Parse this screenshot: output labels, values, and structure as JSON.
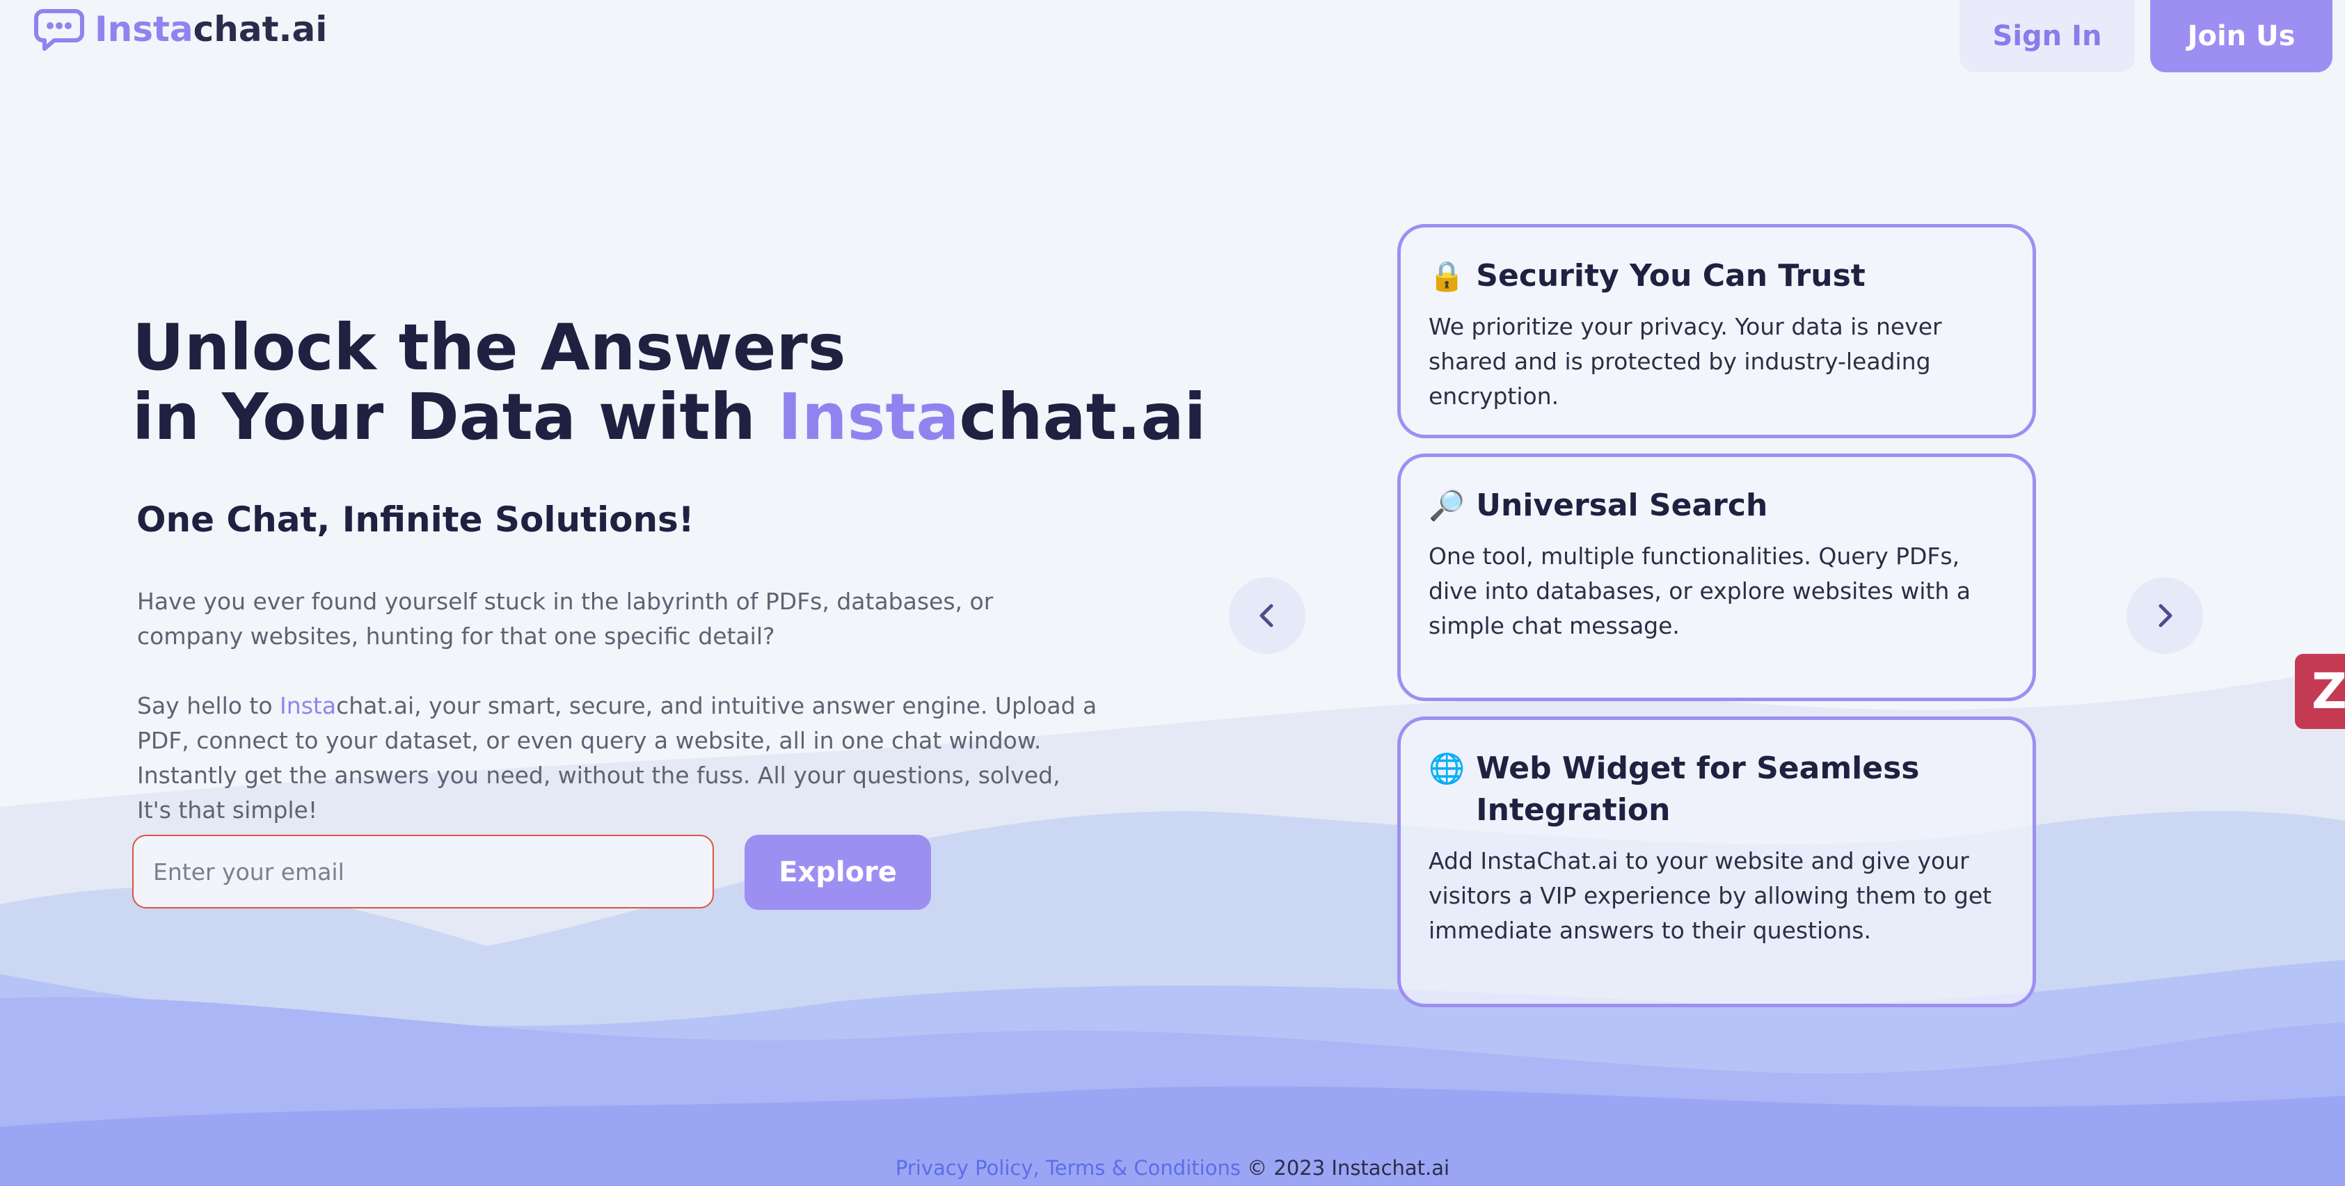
{
  "brand": {
    "name_part1": "Insta",
    "name_part2": "chat.ai",
    "accent_color": "#9282ef",
    "logo_icon": "chat-bubble-icon"
  },
  "header": {
    "signin_label": "Sign In",
    "join_label": "Join Us"
  },
  "hero": {
    "title_line1": "Unlock the Answers",
    "title_line2_prefix": "in Your Data with ",
    "title_brand_part1": "Insta",
    "title_brand_part2": "chat.ai",
    "subtitle": "One Chat, Infinite Solutions!",
    "paragraph1": "Have you ever found yourself stuck in the labyrinth of PDFs, databases, or company websites, hunting for that one specific detail?",
    "paragraph2_prefix": "Say hello to ",
    "paragraph2_brand_part1": "Insta",
    "paragraph2_brand_part2": "chat.ai",
    "paragraph2_suffix": ", your smart, secure, and intuitive answer engine. Upload a PDF, connect to your dataset, or even query a website, all in one chat window. Instantly get the answers you need, without the fuss. All your questions, solved, It's that simple!"
  },
  "signup": {
    "email_placeholder": "Enter your email",
    "explore_label": "Explore"
  },
  "carousel": {
    "prev_icon": "chevron-left-icon",
    "next_icon": "chevron-right-icon",
    "cards": [
      {
        "icon": "lock-icon",
        "emoji": "🔒",
        "title": "Security You Can Trust",
        "text": "We prioritize your privacy. Your data is never shared and is protected by industry-leading encryption."
      },
      {
        "icon": "magnifier-icon",
        "emoji": "🔎",
        "title": "Universal Search",
        "text": "One tool, multiple functionalities. Query PDFs, dive into databases, or explore websites with a simple chat message."
      },
      {
        "icon": "globe-icon",
        "emoji": "🌐",
        "title": "Web Widget for Seamless Integration",
        "text": "Add InstaChat.ai to your website and give your visitors a VIP experience by allowing them to get immediate answers to their questions."
      }
    ]
  },
  "zoho_badge": {
    "letter": "Z"
  },
  "footer": {
    "privacy_label": "Privacy Policy",
    "separator": ", ",
    "terms_label": "Terms & Conditions",
    "copyright": " © 2023 Instachat.ai"
  }
}
